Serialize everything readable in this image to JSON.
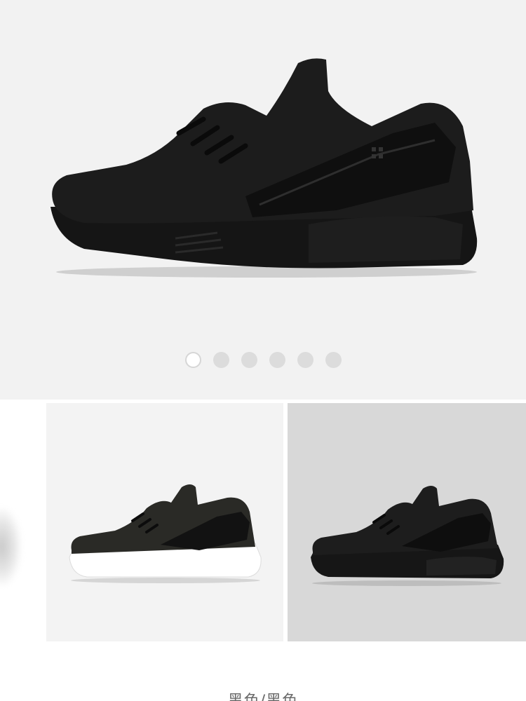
{
  "hero": {
    "image_icon": "black-sneaker-side-view",
    "slide_count": 6,
    "active_slide": 1
  },
  "carousel": {
    "dots": [
      "1",
      "2",
      "3",
      "4",
      "5",
      "6"
    ]
  },
  "colorways": [
    {
      "icon": "white-sneaker-partial"
    },
    {
      "icon": "black-white-sneaker"
    },
    {
      "icon": "all-black-sneaker",
      "selected": true
    }
  ],
  "selected_color_label": "黑色/黑色"
}
